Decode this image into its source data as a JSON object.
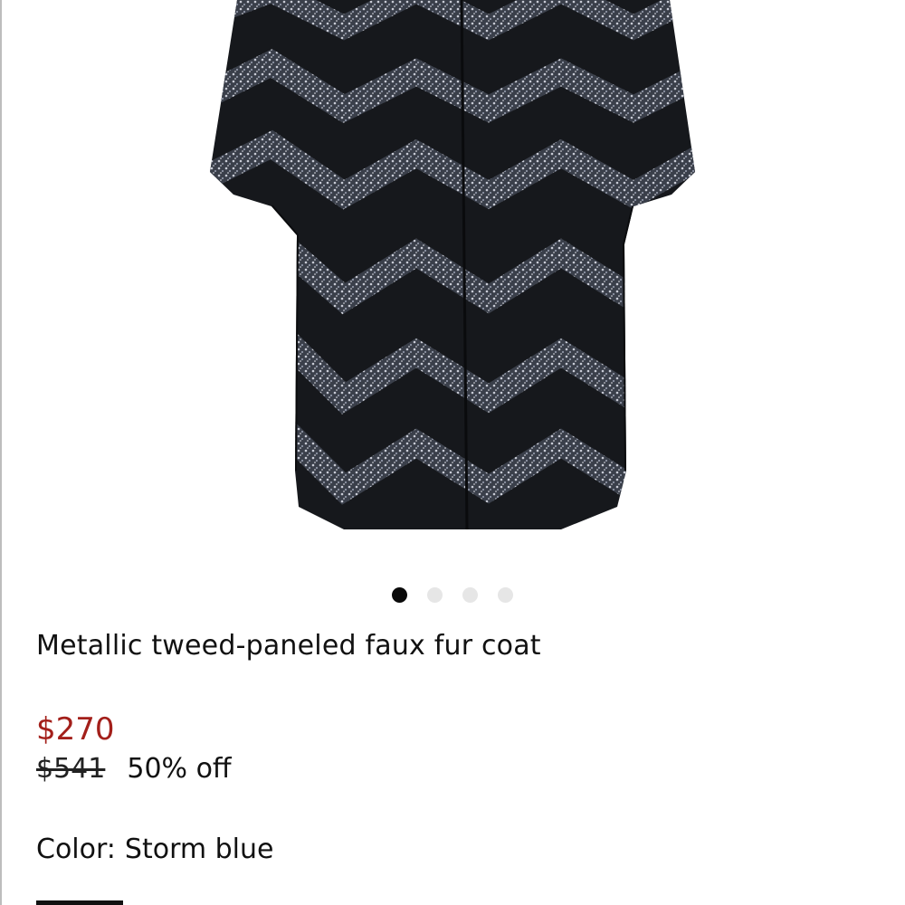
{
  "product": {
    "title": "Metallic tweed-paneled faux fur coat",
    "image_alt": "Black faux fur coat with metallic tweed chevron panels"
  },
  "carousel": {
    "count": 4,
    "active_index": 0
  },
  "pricing": {
    "sale_price": "$270",
    "original_price": "$541",
    "discount": "50% off",
    "sale_color": "#a31f1a"
  },
  "color": {
    "label": "Color:",
    "value": "Storm blue"
  }
}
